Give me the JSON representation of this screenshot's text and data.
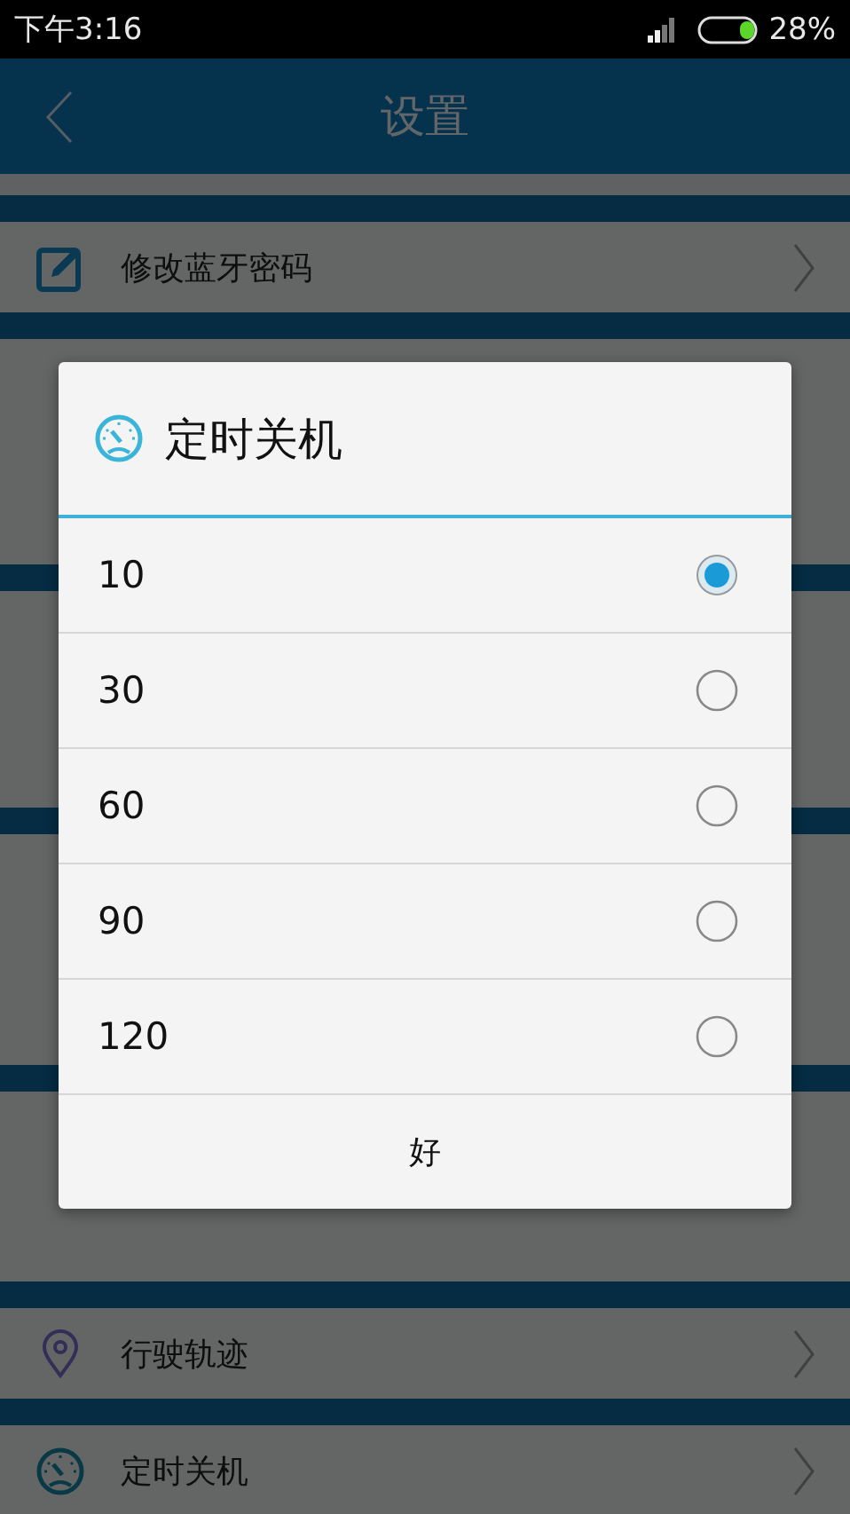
{
  "status_bar": {
    "time": "下午3:16",
    "battery": "28%"
  },
  "header": {
    "title": "设置"
  },
  "settings_top": [
    {
      "label": "修改蓝牙密码"
    }
  ],
  "settings_bottom": [
    {
      "label": "行驶轨迹"
    },
    {
      "label": "定时关机"
    }
  ],
  "dialog": {
    "title": "定时关机",
    "options": [
      {
        "label": "10",
        "selected": true
      },
      {
        "label": "30",
        "selected": false
      },
      {
        "label": "60",
        "selected": false
      },
      {
        "label": "90",
        "selected": false
      },
      {
        "label": "120",
        "selected": false
      }
    ],
    "button": "好"
  }
}
